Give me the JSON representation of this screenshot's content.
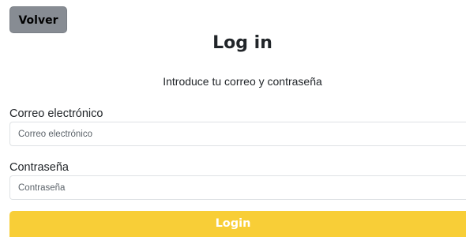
{
  "back_button": {
    "label": "Volver"
  },
  "title": "Log in",
  "subtitle": "Introduce tu correo y contraseña",
  "email": {
    "label": "Correo electrónico",
    "placeholder": "Correo electrónico",
    "value": ""
  },
  "password": {
    "label": "Contraseña",
    "placeholder": "Contraseña",
    "value": ""
  },
  "submit_button": {
    "label": "Login"
  },
  "colors": {
    "back_button_bg": "#878c93",
    "submit_button_bg": "#f8ce37",
    "submit_button_text": "#ffffff",
    "text": "#212529"
  }
}
